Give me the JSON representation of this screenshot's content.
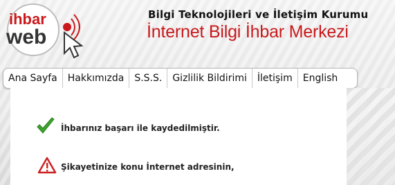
{
  "header": {
    "logo_top": "ihbar",
    "logo_bottom": "web",
    "org_name": "Bilgi Teknolojileri ve İletişim Kurumu",
    "center_name": "İnternet Bilgi İhbar Merkezi"
  },
  "nav": {
    "items": [
      {
        "label": "Ana Sayfa"
      },
      {
        "label": "Hakkımızda"
      },
      {
        "label": "S.S.S."
      },
      {
        "label": "Gizlilik Bildirimi"
      },
      {
        "label": "İletişim"
      },
      {
        "label": "English"
      }
    ]
  },
  "main": {
    "success_message": "İhbarınız başarı ile kaydedilmiştir.",
    "warning_message": "Şikayetinize konu İnternet adresinin,"
  },
  "colors": {
    "brand_red": "#c9191c",
    "check_green": "#3aa52a"
  }
}
